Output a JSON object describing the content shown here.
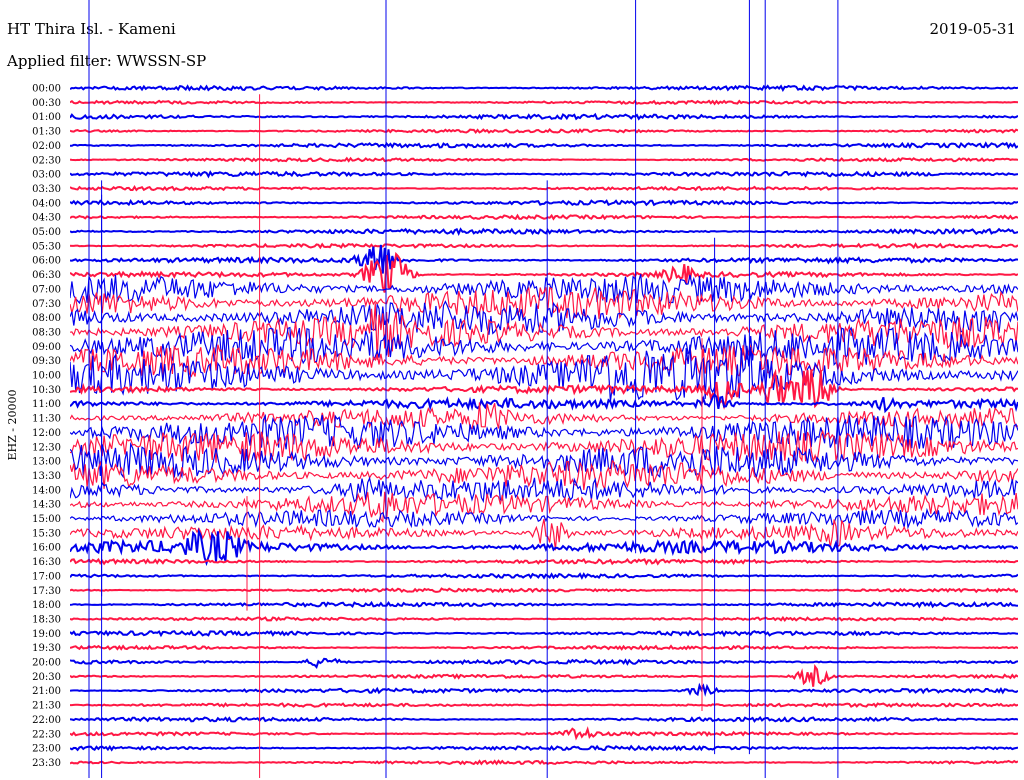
{
  "header": {
    "station": "HT Thira Isl. - Kameni",
    "date": "2019-05-31",
    "filter": "Applied filter: WWSSN-SP"
  },
  "chart_data": {
    "type": "line",
    "title": "HT Thira Isl. - Kameni",
    "date": "2019-05-31",
    "channel_label": "EHZ - 20000",
    "row_labels": [
      "00:00",
      "00:30",
      "01:00",
      "01:30",
      "02:00",
      "02:30",
      "03:00",
      "03:30",
      "04:00",
      "04:30",
      "05:00",
      "05:30",
      "06:00",
      "06:30",
      "07:00",
      "07:30",
      "08:00",
      "08:30",
      "09:00",
      "09:30",
      "10:00",
      "10:30",
      "11:00",
      "11:30",
      "12:00",
      "12:30",
      "13:00",
      "13:30",
      "14:00",
      "14:30",
      "15:00",
      "15:30",
      "16:00",
      "16:30",
      "17:00",
      "17:30",
      "18:00",
      "18:30",
      "19:00",
      "19:30",
      "20:00",
      "20:30",
      "21:00",
      "21:30",
      "22:00",
      "22:30",
      "23:00",
      "23:30"
    ],
    "series": [
      {
        "color": "#0000ee"
      },
      {
        "color": "#ff1744"
      }
    ],
    "noise_level": [
      1.6,
      1.2,
      1.8,
      1.3,
      1.7,
      1.2,
      1.8,
      1.3,
      1.7,
      1.4,
      1.9,
      1.4,
      2.0,
      1.9,
      12,
      13,
      14,
      13,
      15,
      13,
      16,
      3,
      4,
      8,
      14,
      13,
      14,
      12,
      10,
      9,
      7,
      6,
      5,
      1.8,
      1.5,
      1.3,
      1.6,
      1.2,
      1.7,
      1.3,
      1.6,
      1.3,
      1.6,
      1.3,
      1.6,
      1.3,
      1.6,
      1.3
    ],
    "events": [
      {
        "row": 12,
        "minute": 9.7,
        "amplitude": 22
      },
      {
        "row": 13,
        "minute": 9.7,
        "amplitude": 14
      },
      {
        "row": 13,
        "minute": 10.3,
        "amplitude": 18
      },
      {
        "row": 13,
        "minute": 19.3,
        "amplitude": 9
      },
      {
        "row": 17,
        "minute": 9.8,
        "amplitude": 14
      },
      {
        "row": 20,
        "minute": 16.8,
        "amplitude": 18
      },
      {
        "row": 20,
        "minute": 18.2,
        "amplitude": 16
      },
      {
        "row": 20,
        "minute": 19.7,
        "amplitude": 16
      },
      {
        "row": 20,
        "minute": 21.3,
        "amplitude": 14
      },
      {
        "row": 21,
        "minute": 20.7,
        "amplitude": 16
      },
      {
        "row": 21,
        "minute": 22.3,
        "amplitude": 18
      },
      {
        "row": 21,
        "minute": 23.3,
        "amplitude": 16
      },
      {
        "row": 21,
        "minute": 23.8,
        "amplitude": 14
      },
      {
        "row": 22,
        "minute": 20.4,
        "amplitude": 8
      },
      {
        "row": 22,
        "minute": 25.9,
        "amplitude": 6
      },
      {
        "row": 23,
        "minute": 13.2,
        "amplitude": 10
      },
      {
        "row": 28,
        "minute": 9.3,
        "amplitude": 12
      },
      {
        "row": 29,
        "minute": 9.9,
        "amplitude": 10
      },
      {
        "row": 31,
        "minute": 15.2,
        "amplitude": 18
      },
      {
        "row": 31,
        "minute": 24.2,
        "amplitude": 8
      },
      {
        "row": 32,
        "minute": 4.1,
        "amplitude": 10
      },
      {
        "row": 32,
        "minute": 4.9,
        "amplitude": 12
      },
      {
        "row": 40,
        "minute": 8.0,
        "amplitude": 6
      },
      {
        "row": 41,
        "minute": 23.5,
        "amplitude": 10
      },
      {
        "row": 42,
        "minute": 20.0,
        "amplitude": 5
      },
      {
        "row": 45,
        "minute": 16.1,
        "amplitude": 6
      }
    ],
    "spikes": [
      {
        "minute": 6.0,
        "top": "00:30",
        "bottom": "23:30"
      },
      {
        "minute": 1.0,
        "top": "04:00",
        "bottom": "23:30"
      },
      {
        "minute": 0.6,
        "top": "00:00",
        "bottom": "23:30"
      },
      {
        "minute": 10.0,
        "top": "00:00",
        "bottom": "23:30"
      },
      {
        "minute": 15.1,
        "top": "03:30",
        "bottom": "23:30"
      },
      {
        "minute": 17.9,
        "top": "00:00",
        "bottom": "16:00"
      },
      {
        "minute": 20.0,
        "top": "09:00",
        "bottom": "21:30"
      },
      {
        "minute": 20.4,
        "top": "05:30",
        "bottom": "23:00"
      },
      {
        "minute": 21.5,
        "top": "00:00",
        "bottom": "23:00"
      },
      {
        "minute": 22.0,
        "top": "00:00",
        "bottom": "23:30"
      },
      {
        "minute": 24.3,
        "top": "00:00",
        "bottom": "23:30"
      },
      {
        "minute": 1.0,
        "top": "03:30",
        "bottom": "17:30"
      },
      {
        "minute": 5.6,
        "top": "14:30",
        "bottom": "18:00"
      }
    ]
  }
}
